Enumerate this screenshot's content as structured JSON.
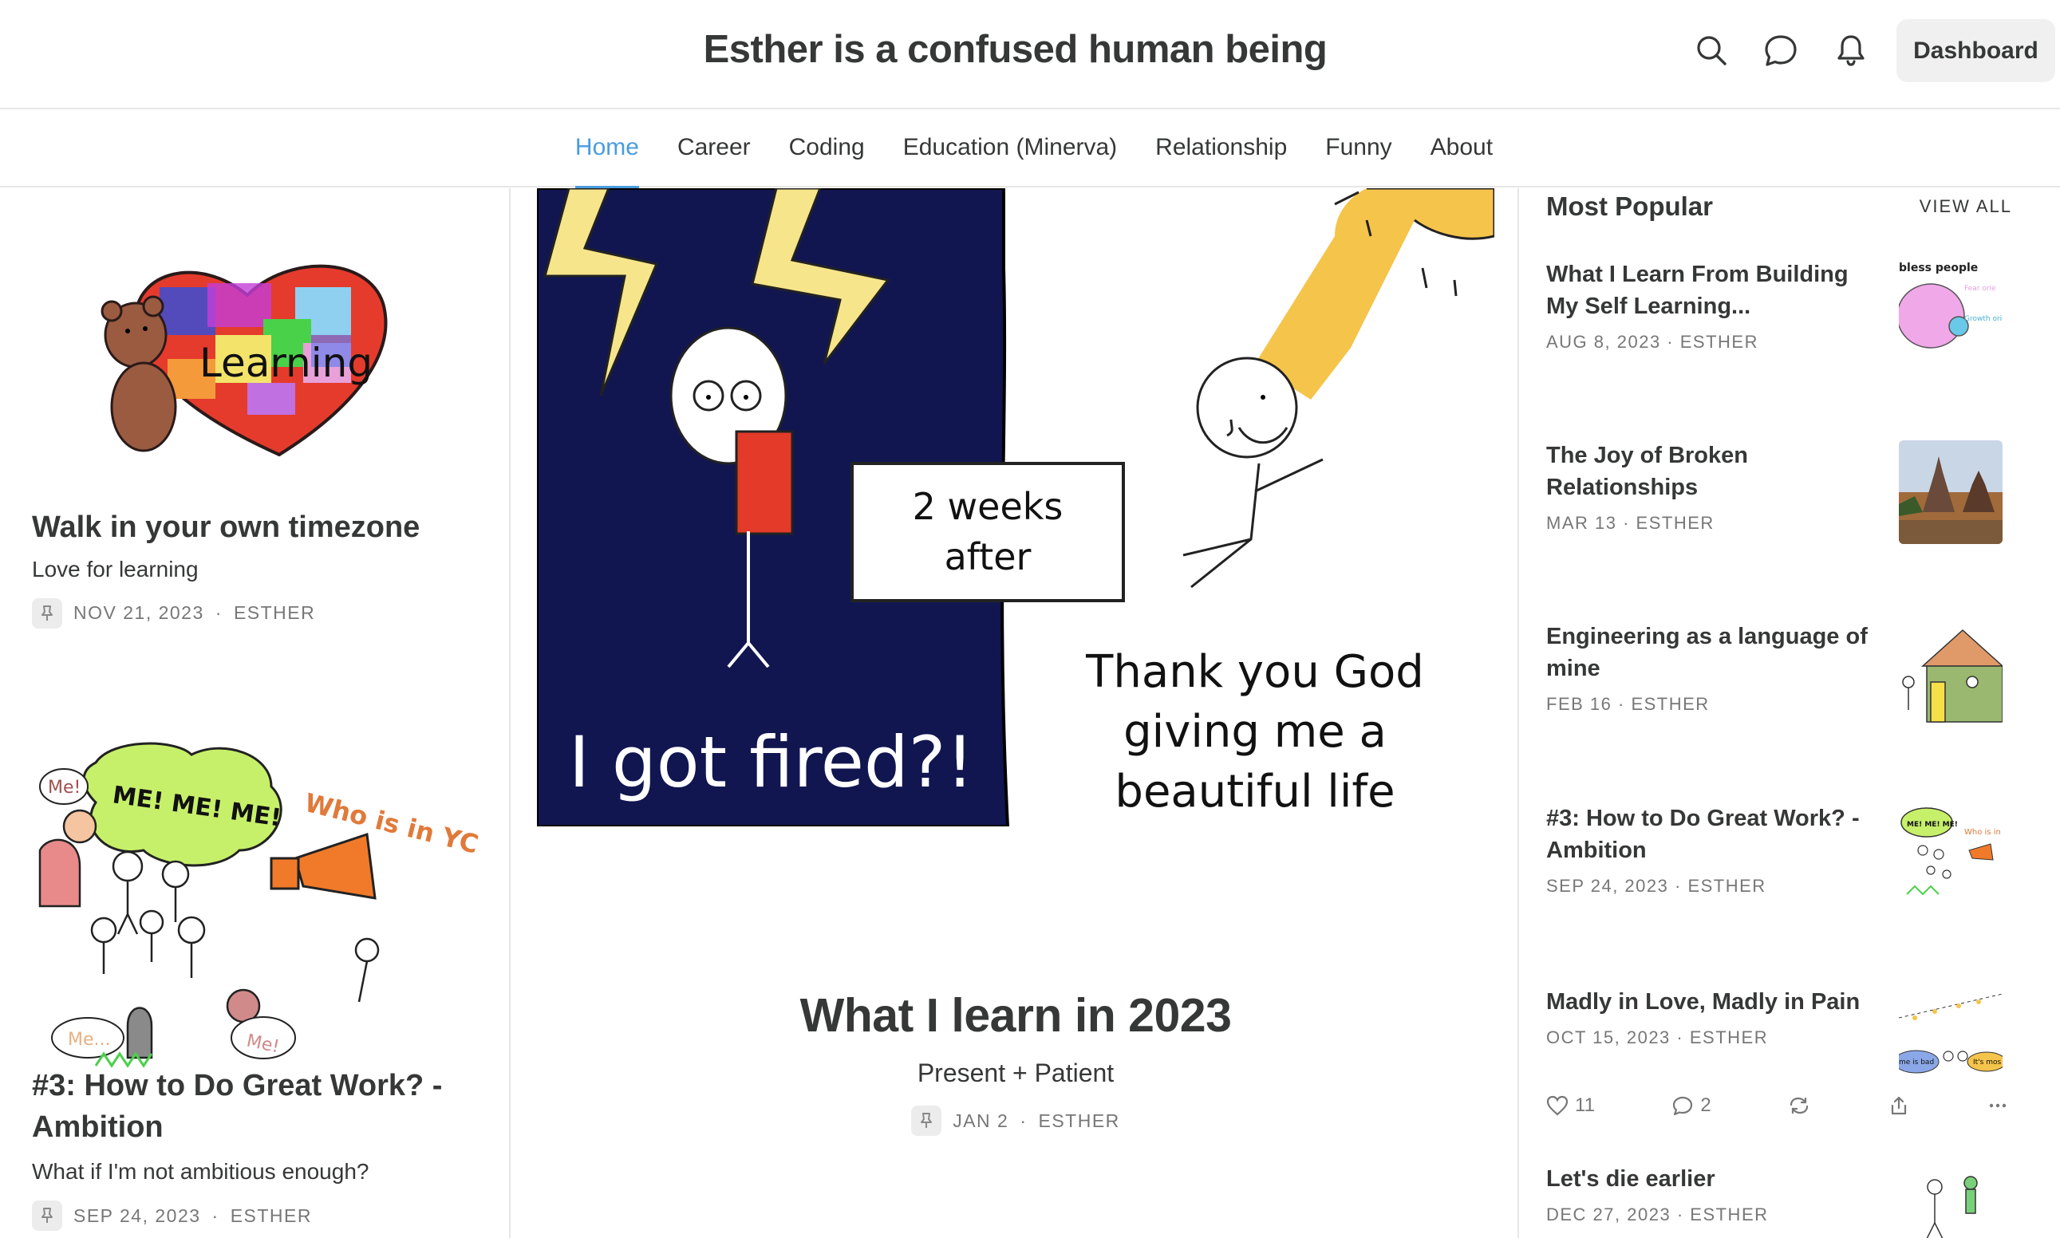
{
  "header": {
    "site_title": "Esther is a confused human being",
    "dashboard_label": "Dashboard",
    "icons": [
      "search-icon",
      "chat-icon",
      "bell-icon"
    ]
  },
  "nav": {
    "tabs": [
      {
        "label": "Home",
        "active": true
      },
      {
        "label": "Career",
        "active": false
      },
      {
        "label": "Coding",
        "active": false
      },
      {
        "label": "Education (Minerva)",
        "active": false
      },
      {
        "label": "Relationship",
        "active": false
      },
      {
        "label": "Funny",
        "active": false
      },
      {
        "label": "About",
        "active": false
      }
    ],
    "active_color": "#4a9ce0"
  },
  "left": {
    "posts": [
      {
        "image_text": "Learning",
        "title": "Walk in your own timezone",
        "subtitle": "Love for learning",
        "date": "NOV 21, 2023",
        "author": "ESTHER"
      },
      {
        "image_texts": [
          "Me!",
          "ME! ME! ME!",
          "Who is in YC?",
          "Me...",
          "Me!"
        ],
        "title": "#3: How to Do Great Work? - Ambition",
        "subtitle": "What if I'm not ambitious enough?",
        "date": "SEP 24, 2023",
        "author": "ESTHER"
      }
    ]
  },
  "featured": {
    "image_texts": {
      "fired": "I got fired?!",
      "weeks_line1": "2 weeks",
      "weeks_line2": "after",
      "thanks_line1": "Thank you God",
      "thanks_line2": "giving me a",
      "thanks_line3": "beautiful life"
    },
    "title": "What I learn in 2023",
    "subtitle": "Present + Patient",
    "date": "JAN 2",
    "author": "ESTHER"
  },
  "popular": {
    "heading": "Most Popular",
    "view_all": "VIEW ALL",
    "items": [
      {
        "title": "What I Learn From Building My Self Learning...",
        "date": "AUG 8, 2023",
        "author": "ESTHER",
        "thumb_texts": [
          "bless people",
          "Fear orie",
          "Growth oriented"
        ]
      },
      {
        "title": "The Joy of Broken Relationships",
        "date": "MAR 13",
        "author": "ESTHER"
      },
      {
        "title": "Engineering as a language of mine",
        "date": "FEB 16",
        "author": "ESTHER"
      },
      {
        "title": "#3: How to Do Great Work? - Ambition",
        "date": "SEP 24, 2023",
        "author": "ESTHER",
        "thumb_texts": [
          "ME! ME! ME!",
          "Who is in Y"
        ]
      },
      {
        "title": "Madly in Love, Madly in Pain",
        "date": "OCT 15, 2023",
        "author": "ESTHER",
        "thumb_texts": [
          "me is bad",
          "It's mos"
        ]
      },
      {
        "title": "Let's die earlier",
        "date": "DEC 27, 2023",
        "author": "ESTHER"
      }
    ],
    "actions": {
      "likes": "11",
      "comments": "2"
    }
  }
}
